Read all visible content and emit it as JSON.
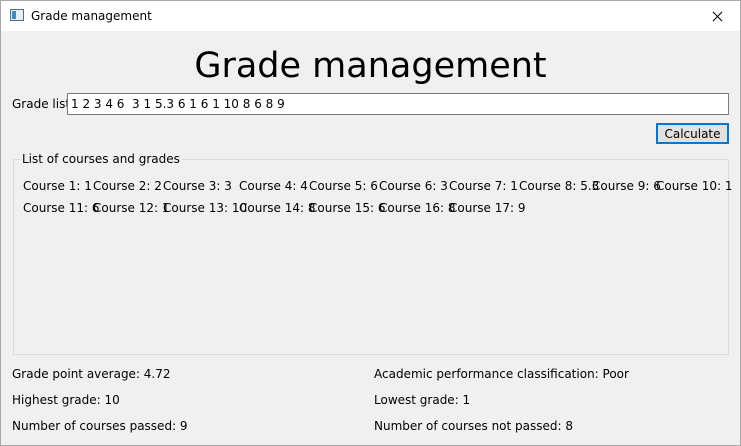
{
  "window": {
    "title": "Grade management"
  },
  "header": {
    "title": "Grade management"
  },
  "input": {
    "label": "Grade list",
    "value": "1 2 3 4 6  3 1 5.3 6 1 6 1 10 8 6 8 9"
  },
  "buttons": {
    "calculate": "Calculate"
  },
  "courses": {
    "caption": "List of courses and grades",
    "items": [
      "Course 1: 1",
      "Course 2: 2",
      "Course 3: 3",
      "Course 4: 4",
      "Course 5: 6",
      "Course 6: 3",
      "Course 7: 1",
      "Course 8: 5.3",
      "Course 9: 6",
      "Course 10: 1",
      "Course 11: 6",
      "Course 12: 1",
      "Course 13: 10",
      "Course 14: 8",
      "Course 15: 6",
      "Course 16: 8",
      "Course 17: 9"
    ]
  },
  "stats": {
    "gpa": "Grade point average:  4.72",
    "classification": "Academic performance classification:  Poor",
    "highest": "Highest grade:  10",
    "lowest": "Lowest grade:  1",
    "passed": "Number of courses passed:  9",
    "not_passed": "Number of courses not passed:  8"
  }
}
